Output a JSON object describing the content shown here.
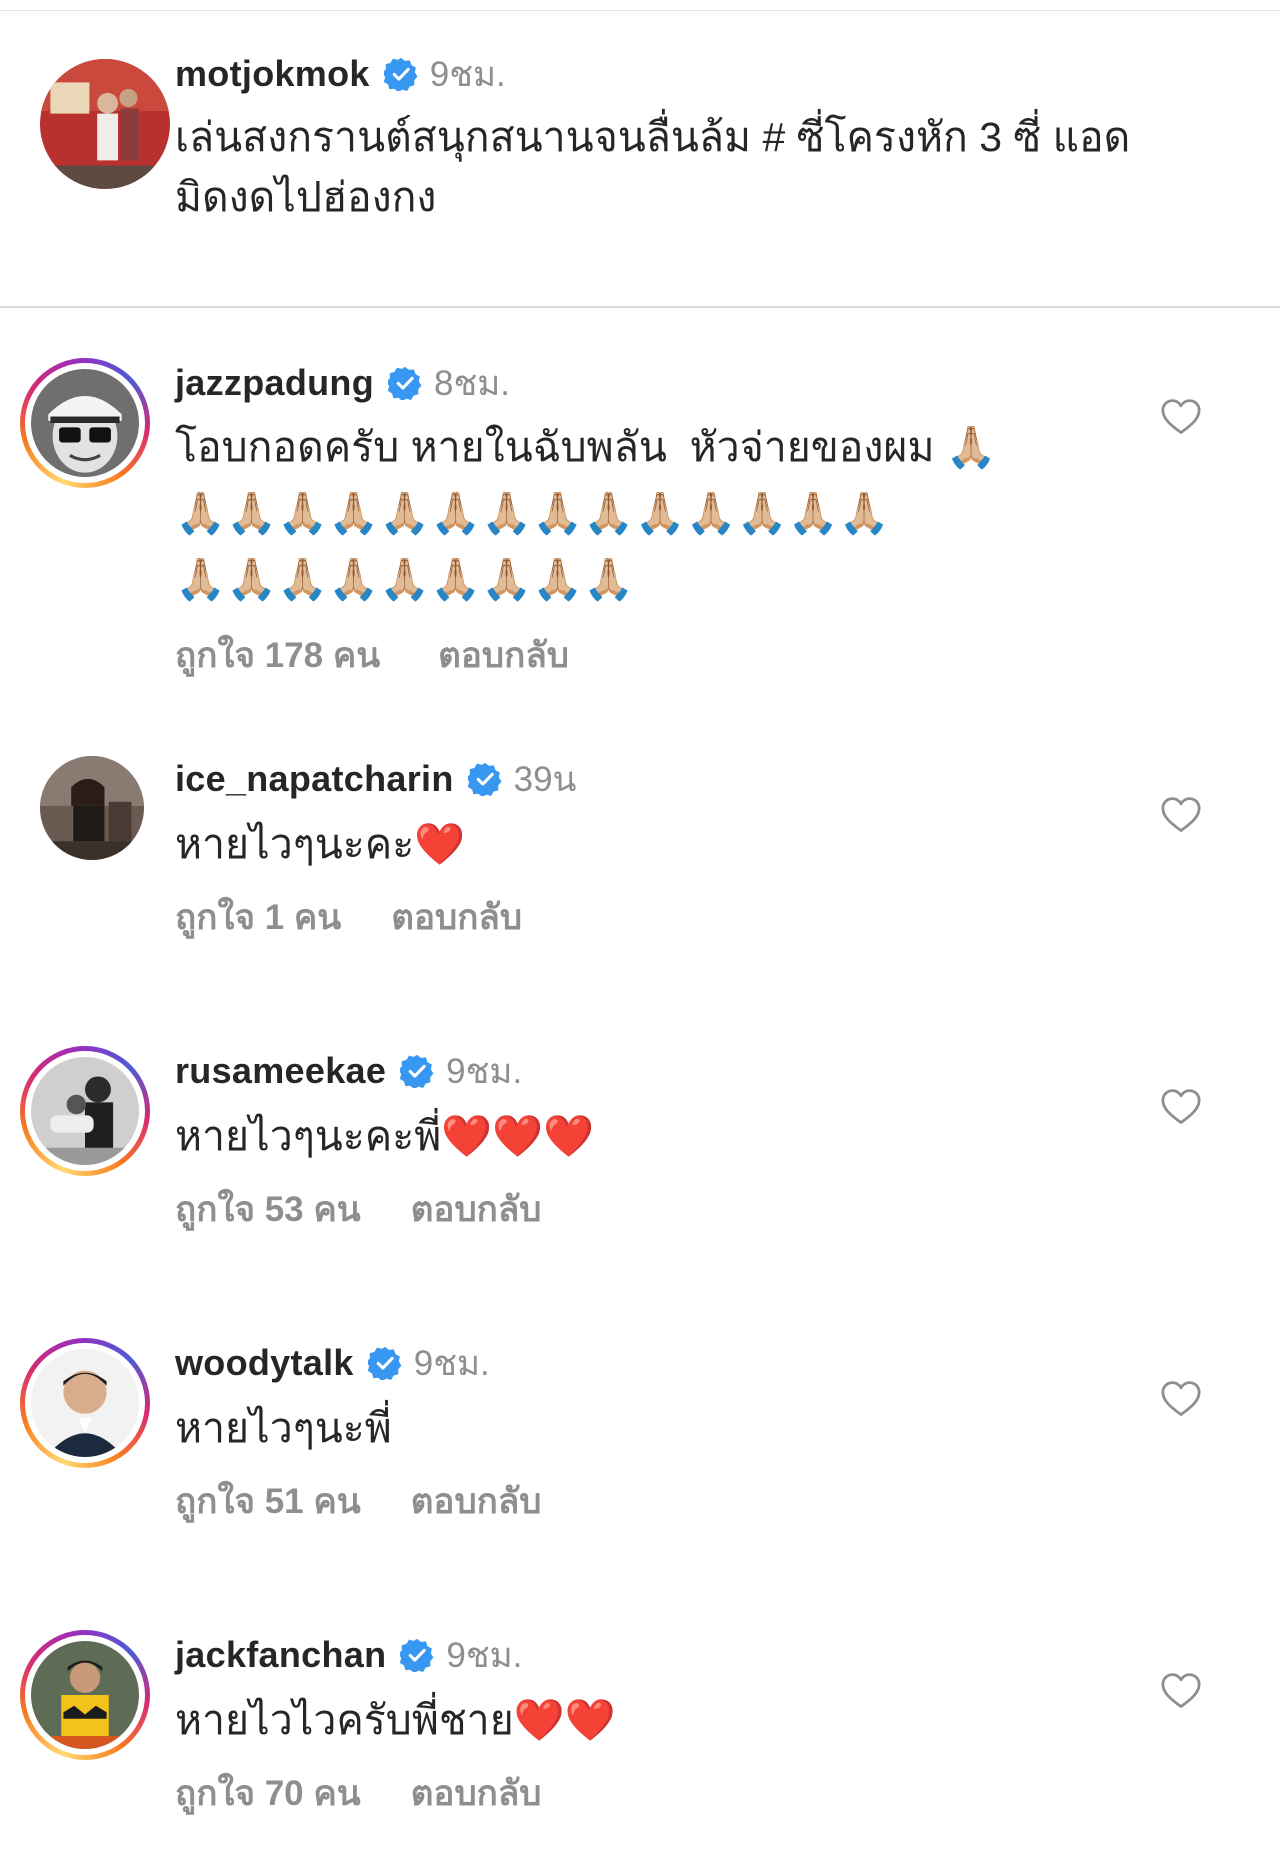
{
  "caption": {
    "username": "motjokmok",
    "time": "9ชม.",
    "text": "เล่นสงกรานต์สนุกสนานจนลื่นล้ม # ซี่โครงหัก 3 ซี่ แอด\nมิดงดไปฮ่องกง"
  },
  "comments": [
    {
      "username": "jazzpadung",
      "time": "8ชม.",
      "text": "โอบกอดครับ หายในฉับพลัน  หัวจ่ายของผม 🙏🏼\n🙏🏼🙏🏼🙏🏼🙏🏼🙏🏼🙏🏼🙏🏼🙏🏼🙏🏼🙏🏼🙏🏼🙏🏼🙏🏼🙏🏼\n🙏🏼🙏🏼🙏🏼🙏🏼🙏🏼🙏🏼🙏🏼🙏🏼🙏🏼",
      "likes": "ถูกใจ 178 คน",
      "reply": "ตอบกลับ"
    },
    {
      "username": "ice_napatcharin",
      "time": "39น",
      "text": "หายไวๆนะคะ❤️",
      "likes": "ถูกใจ 1 คน",
      "reply": "ตอบกลับ"
    },
    {
      "username": "rusameekae",
      "time": "9ชม.",
      "text": "หายไวๆนะคะพี่❤️❤️❤️",
      "likes": "ถูกใจ 53 คน",
      "reply": "ตอบกลับ"
    },
    {
      "username": "woodytalk",
      "time": "9ชม.",
      "text": "หายไวๆนะพี่",
      "likes": "ถูกใจ 51 คน",
      "reply": "ตอบกลับ"
    },
    {
      "username": "jackfanchan",
      "time": "9ชม.",
      "text": "หายไวไวครับพี่ชาย❤️❤️",
      "likes": "ถูกใจ 70 คน",
      "reply": "ตอบกลับ"
    }
  ],
  "icons": {
    "verified": "verified-badge-icon",
    "like": "heart-outline-icon"
  },
  "colors": {
    "verified": "#3897f0",
    "muted": "#8e8e8e",
    "text": "#262626"
  }
}
